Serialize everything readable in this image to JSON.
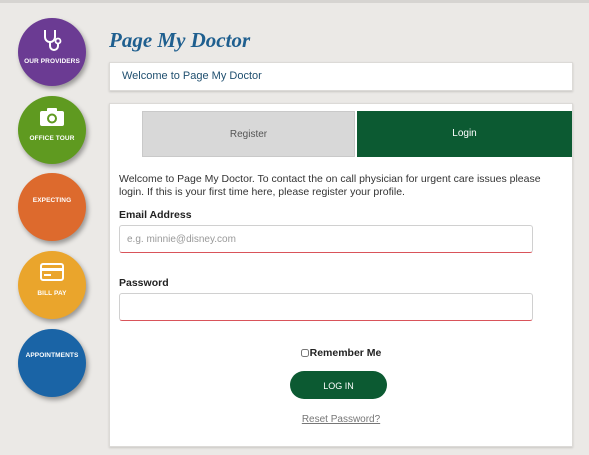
{
  "app": {
    "title": "Page My Doctor"
  },
  "nav": {
    "providers": "OUR PROVIDERS",
    "tour": "OFFICE TOUR",
    "expecting": "EXPECTING",
    "bill": "BILL PAY",
    "appointments": "APPOINTMENTS"
  },
  "welcome": "Welcome to Page My Doctor",
  "tabs": {
    "register": "Register",
    "login": "Login",
    "active": "Login"
  },
  "intro": "Welcome to Page My Doctor. To contact the on call physician for urgent care issues please login. If this is your first time here, please register your profile.",
  "form": {
    "email_label": "Email Address",
    "email_placeholder": "e.g. minnie@disney.com",
    "email_value": "",
    "password_label": "Password",
    "password_value": "",
    "remember_label": "Remember Me",
    "remember_checked": false,
    "login_label": "LOG IN",
    "reset_label": "Reset Password?"
  },
  "colors": {
    "providers": "#6b3b93",
    "tour": "#5f9a20",
    "expecting": "#dd6a2d",
    "bill": "#eaa52c",
    "appointments": "#1a64a6",
    "brand_green": "#0c5a32",
    "title_blue": "#1f5f8f"
  },
  "icons": {
    "providers": "stethoscope-icon",
    "tour": "camera-icon",
    "bill": "credit-card-icon"
  }
}
